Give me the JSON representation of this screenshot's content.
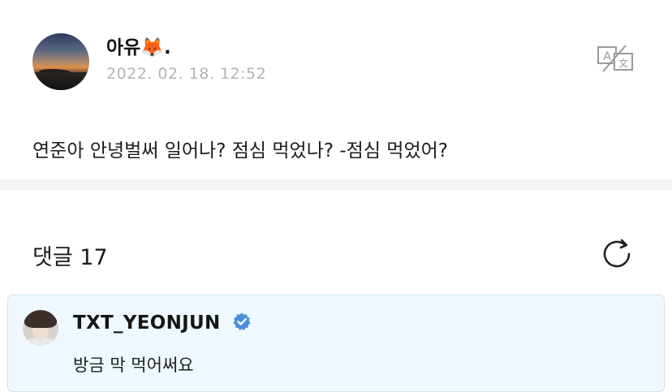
{
  "post": {
    "author": {
      "name": "아유🦊.",
      "avatar_icon": "sunset-landscape-avatar"
    },
    "timestamp": "2022. 02. 18. 12:52",
    "translate_icon": "translate-icon",
    "body": "연준아 안녕벌써 일어나? 점심 먹었나? -점심 먹었어?"
  },
  "comments": {
    "label": "댓글 17",
    "refresh_icon": "refresh-icon",
    "items": [
      {
        "author": "TXT_YEONJUN",
        "verified": true,
        "text": "방금 막 먹어써요"
      }
    ]
  },
  "colors": {
    "divider": "#f3f4f6",
    "timestamp": "#b3b3b3",
    "verified": "#4a8fd8",
    "comment_bg": "#eef8fe",
    "comment_border": "#cfe4f1"
  }
}
